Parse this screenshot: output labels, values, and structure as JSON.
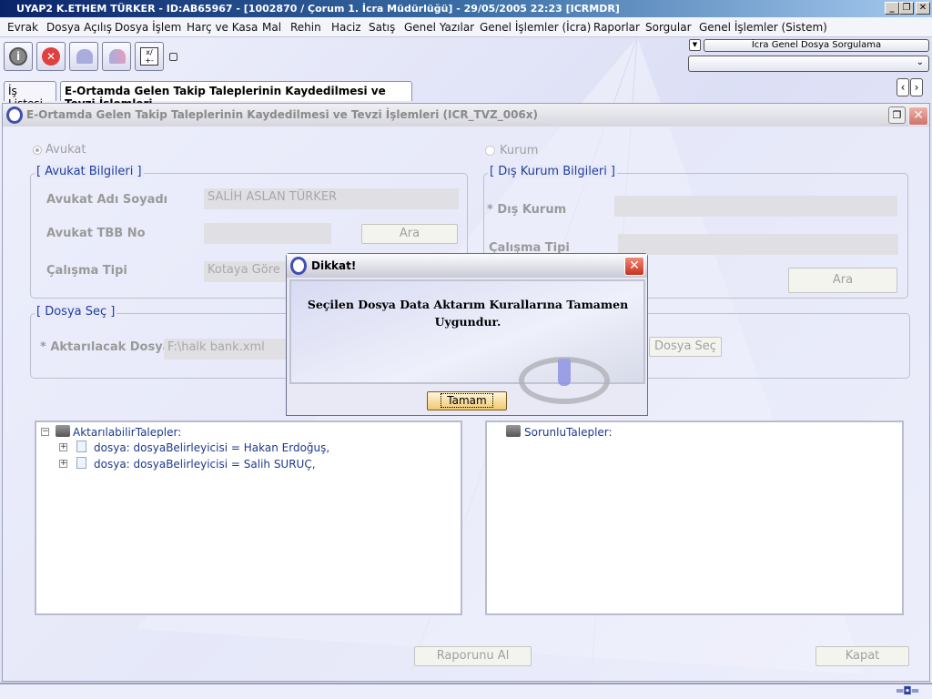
{
  "window": {
    "title": "UYAP2  K.ETHEM TÜRKER - ID:AB65967 - [1002870 / Çorum 1. İcra Müdürlüğü] - 29/05/2005 22:23 [ICRMDR]",
    "minimize": "_",
    "maximize": "❐",
    "close": "✕"
  },
  "menu": [
    "Evrak",
    "Dosya Açılış",
    "Dosya İşlem",
    "Harç ve Kasa",
    "Mal",
    "Rehin",
    "Haciz",
    "Satış",
    "Genel Yazılar",
    "Genel İşlemler (İcra)",
    "Raporlar",
    "Sorgular",
    "Genel İşlemler (Sistem)"
  ],
  "toolbar": {
    "icons": [
      "info-icon",
      "cancel-icon",
      "users-icon",
      "users-alt-icon",
      "calculator-icon"
    ],
    "query_button": "İcra Genel Dosya Sorgulama",
    "query_select": ""
  },
  "tabs": [
    {
      "label": "İş Listesi",
      "active": false
    },
    {
      "label": "E-Ortamda Gelen Takip Taleplerinin Kaydedilmesi ve Tevzi İşlemleri",
      "active": true
    }
  ],
  "frame": {
    "title": "E-Ortamda Gelen Takip Taleplerinin Kaydedilmesi ve Tevzi İşlemleri (ICR_TVZ_006x)",
    "radio": {
      "avukat": "Avukat",
      "kurum": "Kurum",
      "selected": "Avukat"
    },
    "avukat_group": {
      "legend": "[ Avukat Bilgileri ]",
      "name_label": "Avukat Adı Soyadı",
      "name_value": "SALİH ASLAN TÜRKER",
      "tbb_label": "Avukat TBB No",
      "tbb_value": "",
      "search": "Ara",
      "work_label": "Çalışma Tipi",
      "work_value": "Kotaya Göre"
    },
    "kurum_group": {
      "legend": "[ Dış Kurum Bilgileri ]",
      "kurum_label": "* Dış Kurum",
      "kurum_value": "",
      "work_label": "Çalışma Tipi",
      "work_value": "",
      "search": "Ara"
    },
    "file_group": {
      "legend": "[ Dosya Seç ]",
      "label": "* Aktarılacak Dosya",
      "value": "F:\\halk bank.xml",
      "button": "Dosya Seç"
    },
    "left_tree": {
      "root": "AktarılabilirTalepler:",
      "items": [
        "dosya: dosyaBelirleyicisi = Hakan Erdoğuş,",
        "dosya: dosyaBelirleyicisi = Salih SURUÇ,"
      ]
    },
    "right_tree": {
      "root": "SorunluTalepler:"
    },
    "report_button": "Raporunu Al",
    "close_button": "Kapat"
  },
  "dialog": {
    "title": "Dikkat!",
    "message": "Seçilen Dosya Data Aktarım Kurallarına Tamamen Uygundur.",
    "ok": "Tamam"
  }
}
